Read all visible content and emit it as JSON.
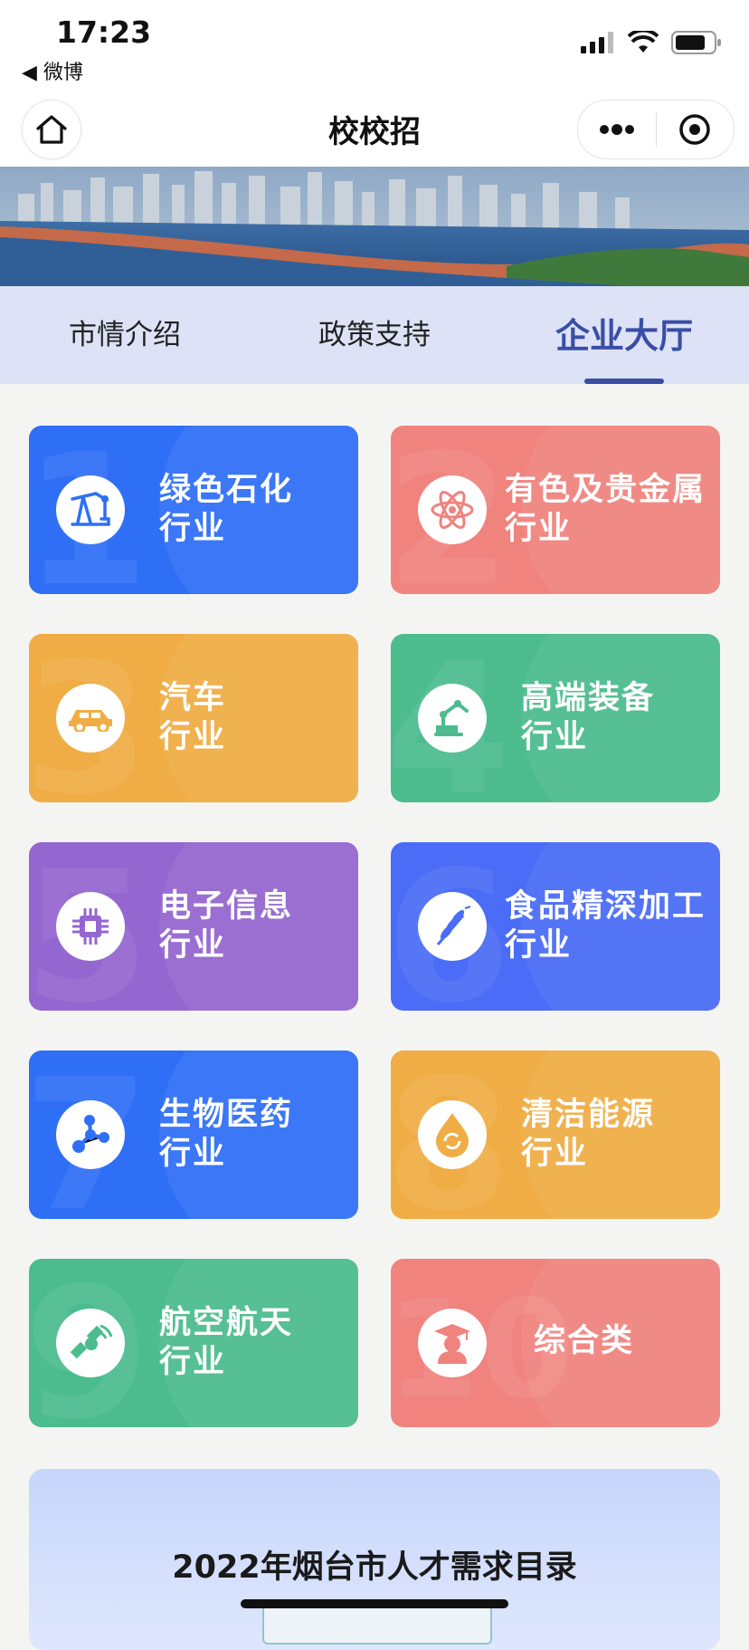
{
  "status_bar": {
    "time": "17:23",
    "back_app": "◀ 微博"
  },
  "nav": {
    "title": "校校招"
  },
  "tabs": [
    {
      "label": "市情介绍",
      "active": false
    },
    {
      "label": "政策支持",
      "active": false
    },
    {
      "label": "企业大厅",
      "active": true
    }
  ],
  "industries": [
    {
      "number": "1",
      "line1": "绿色石化",
      "line2": "行业",
      "icon": "oil-pump-icon",
      "color": "#2f6ff6"
    },
    {
      "number": "2",
      "line1": "有色及贵金属",
      "line2": "行业",
      "icon": "atom-icon",
      "color": "#f0837e"
    },
    {
      "number": "3",
      "line1": "汽车",
      "line2": "行业",
      "icon": "car-icon",
      "color": "#f0ad45"
    },
    {
      "number": "4",
      "line1": "高端装备",
      "line2": "行业",
      "icon": "robot-arm-icon",
      "color": "#4cbc8e"
    },
    {
      "number": "5",
      "line1": "电子信息",
      "line2": "行业",
      "icon": "chip-icon",
      "color": "#9466cf"
    },
    {
      "number": "6",
      "line1": "食品精深加工",
      "line2": "行业",
      "icon": "wheat-icon",
      "color": "#4a6cf6"
    },
    {
      "number": "7",
      "line1": "生物医药",
      "line2": "行业",
      "icon": "molecule-icon",
      "color": "#2f6ff6"
    },
    {
      "number": "8",
      "line1": "清洁能源",
      "line2": "行业",
      "icon": "energy-drop-icon",
      "color": "#f0ad45"
    },
    {
      "number": "9",
      "line1": "航空航天",
      "line2": "行业",
      "icon": "satellite-icon",
      "color": "#4cbc8e"
    },
    {
      "number": "10",
      "line1": "综合类",
      "line2": "",
      "icon": "graduate-icon",
      "color": "#f0837e"
    }
  ],
  "bottom_banner": {
    "title": "2022年烟台市人才需求目录"
  }
}
